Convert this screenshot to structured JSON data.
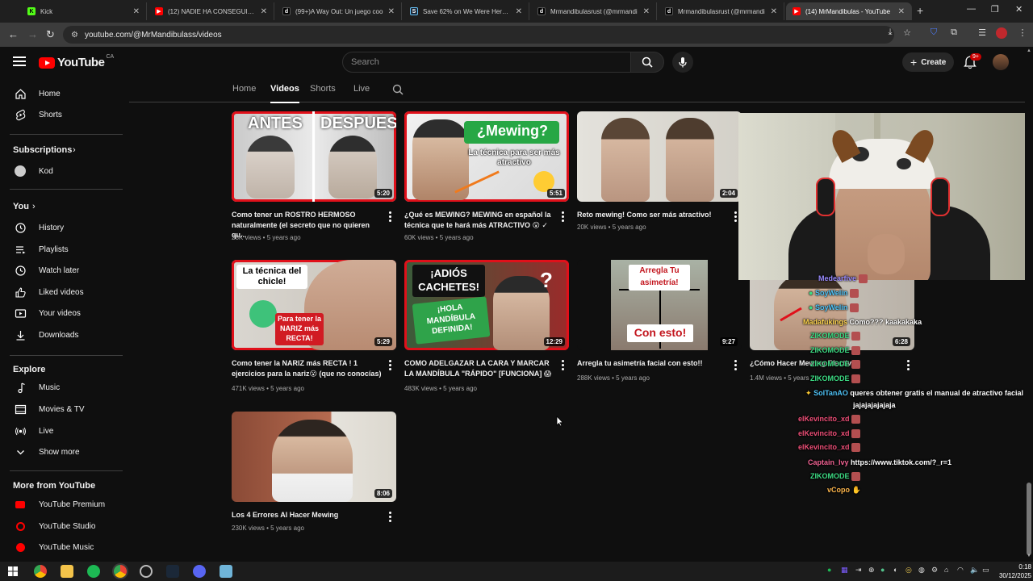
{
  "tabs": [
    {
      "title": "Kick",
      "color": "#53fc18",
      "glyph": "K"
    },
    {
      "title": "(12) NADIE HA CONSEGUIDO E",
      "color": "#ff0000",
      "glyph": "▶"
    },
    {
      "title": "(99+)A Way Out: Un juego coo",
      "color": "#111111",
      "glyph": "d"
    },
    {
      "title": "Save 62% on We Were Here To",
      "color": "#1b2838",
      "glyph": "S"
    },
    {
      "title": "Mrmandibulasrust (@mrmandi",
      "color": "#111111",
      "glyph": "d"
    },
    {
      "title": "Mrmandibulasrust (@mrmandi",
      "color": "#111111",
      "glyph": "d"
    },
    {
      "title": "(14) MrMandibulas - YouTube",
      "color": "#ff0000",
      "glyph": "▶"
    }
  ],
  "address": {
    "url": "youtube.com/@MrMandibulass/videos"
  },
  "header": {
    "logo_word": "YouTube",
    "country": "CA",
    "search_placeholder": "Search",
    "create_label": "Create",
    "notif_badge": "9+"
  },
  "sidebar": {
    "main": [
      {
        "label": "Home",
        "icon": "home-icon"
      },
      {
        "label": "Shorts",
        "icon": "shorts-icon"
      }
    ],
    "subscriptions_heading": "Subscriptions",
    "subscriptions": [
      {
        "label": "Kod"
      }
    ],
    "you_heading": "You",
    "you": [
      {
        "label": "History",
        "icon": "history-icon"
      },
      {
        "label": "Playlists",
        "icon": "playlists-icon"
      },
      {
        "label": "Watch later",
        "icon": "watch-later-icon"
      },
      {
        "label": "Liked videos",
        "icon": "liked-icon"
      },
      {
        "label": "Your videos",
        "icon": "your-videos-icon"
      },
      {
        "label": "Downloads",
        "icon": "downloads-icon"
      }
    ],
    "explore_heading": "Explore",
    "explore": [
      {
        "label": "Music",
        "icon": "music-icon"
      },
      {
        "label": "Movies & TV",
        "icon": "movies-icon"
      },
      {
        "label": "Live",
        "icon": "live-icon"
      },
      {
        "label": "Show more",
        "icon": "chevron-down-icon"
      }
    ],
    "more_heading": "More from YouTube",
    "more": [
      {
        "label": "YouTube Premium"
      },
      {
        "label": "YouTube Studio"
      },
      {
        "label": "YouTube Music"
      }
    ]
  },
  "channel_tabs": [
    "Home",
    "Videos",
    "Shorts",
    "Live"
  ],
  "videos": [
    {
      "title": "Como tener un ROSTRO HERMOSO naturalmente (el secreto que no quieren qu...",
      "meta": "28K views • 5 years ago",
      "duration": "5:20",
      "overlay": [
        "ANTES",
        "DESPUES"
      ]
    },
    {
      "title": "¿Qué es MEWING? MEWING en español la técnica que te hará más ATRACTIVO 😮 ✓",
      "meta": "60K views • 5 years ago",
      "duration": "5:51",
      "overlay": [
        "¿Mewing?",
        "La técnica para ser más atractivo"
      ]
    },
    {
      "title": "Reto mewing! Como ser más atractivo!",
      "meta": "20K views • 5 years ago",
      "duration": "2:04",
      "overlay": []
    },
    {
      "title": "Como tener la NARIZ más RECTA ! 1 ejercicios para la nariz😮 (que no conocías)",
      "meta": "471K views • 5 years ago",
      "duration": "5:29",
      "overlay": [
        "La técnica del chicle!",
        "Para tener la NARIZ más RECTA!"
      ]
    },
    {
      "title": "COMO ADELGAZAR LA CARA Y MARCAR LA MANDÍBULA \"RÁPIDO\" [FUNCIONA] 😱",
      "meta": "483K views • 5 years ago",
      "duration": "12:29",
      "overlay": [
        "¡ADIÓS CACHETES!",
        "¡HOLA MANDÍBULA DEFINIDA!",
        "?"
      ]
    },
    {
      "title": "Arregla tu asimetría facial con esto!!",
      "meta": "288K views • 5 years ago",
      "duration": "9:27",
      "overlay": [
        "Arregla Tu asimetría!",
        "Con esto!"
      ]
    },
    {
      "title": "¿Cómo Hacer Mewing Efectiva!",
      "meta": "1.4M views • 5 years",
      "duration": "6:28",
      "overlay": []
    },
    {
      "title": "Los 4 Errores Al Hacer Mewing",
      "meta": "230K views • 5 years ago",
      "duration": "8:06",
      "overlay": []
    }
  ],
  "chat": [
    {
      "user": "Medearfive",
      "msg": "",
      "color": "#9b8cff"
    },
    {
      "user": "SoyWelin",
      "msg": "",
      "color": "#4fc3f7"
    },
    {
      "user": "SoyWelin",
      "msg": "",
      "color": "#4fc3f7"
    },
    {
      "user": "Madafukings",
      "msg": "Como??? kaakakaka",
      "color": "#ffd54f"
    },
    {
      "user": "ZIKOMODE",
      "msg": "",
      "color": "#3ddc84"
    },
    {
      "user": "ZIKOMODE",
      "msg": "",
      "color": "#3ddc84"
    },
    {
      "user": "ZIKOMODE",
      "msg": "",
      "color": "#3ddc84"
    },
    {
      "user": "ZIKOMODE",
      "msg": "",
      "color": "#3ddc84"
    },
    {
      "user": "SolTanAO",
      "msg": "queres obtener gratis el manual de atractivo facial",
      "msg2": "jajajajajajaja",
      "color": "#4fc3f7"
    },
    {
      "user": "elKevincito_xd",
      "msg": "",
      "color": "#ef4f78"
    },
    {
      "user": "elKevincito_xd",
      "msg": "",
      "color": "#ef4f78"
    },
    {
      "user": "elKevincito_xd",
      "msg": "",
      "color": "#ef4f78"
    },
    {
      "user": "Captain_Ivy",
      "msg": "https://www.tiktok.com/?_r=1",
      "color": "#f06292"
    },
    {
      "user": "ZIKOMODE",
      "msg": "",
      "color": "#3ddc84"
    },
    {
      "user": "vCopo",
      "msg": "",
      "color": "#ffb74d"
    }
  ],
  "clock": {
    "time": "0:18",
    "date": "30/12/2025"
  }
}
